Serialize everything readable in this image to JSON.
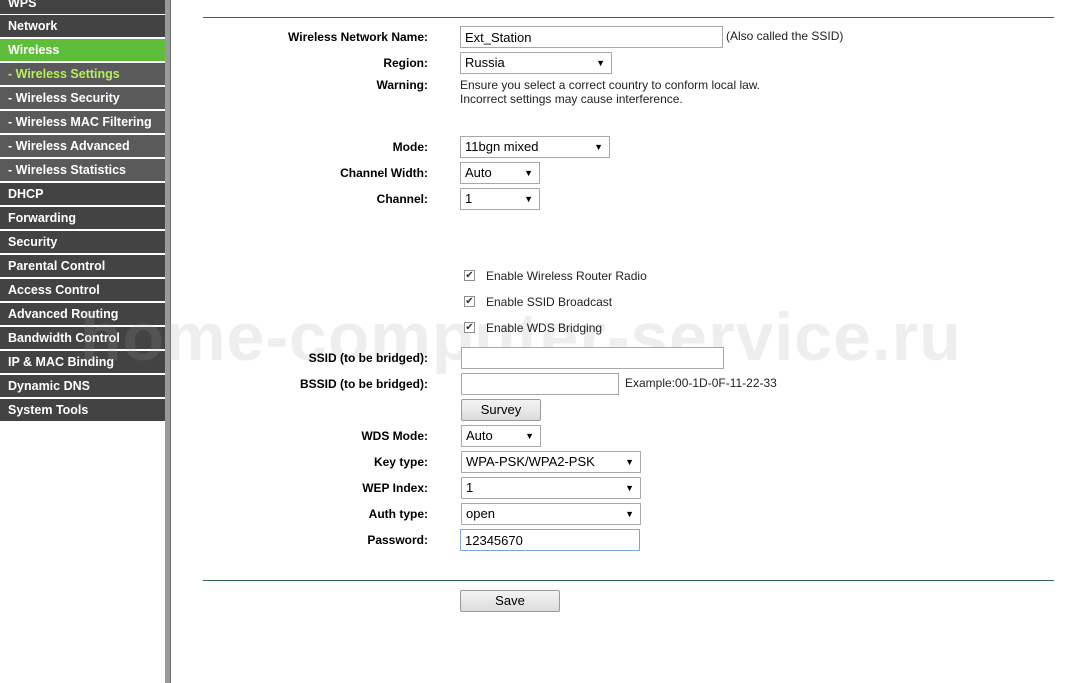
{
  "sidebar": {
    "items": [
      {
        "label": "WPS",
        "active": false,
        "sub": false
      },
      {
        "label": "Network",
        "active": false,
        "sub": false
      },
      {
        "label": "Wireless",
        "active": true,
        "sub": false
      },
      {
        "label": "- Wireless Settings",
        "active": true,
        "sub": true
      },
      {
        "label": "- Wireless Security",
        "active": false,
        "sub": true
      },
      {
        "label": "- Wireless MAC Filtering",
        "active": false,
        "sub": true
      },
      {
        "label": "- Wireless Advanced",
        "active": false,
        "sub": true
      },
      {
        "label": "- Wireless Statistics",
        "active": false,
        "sub": true
      },
      {
        "label": "DHCP",
        "active": false,
        "sub": false
      },
      {
        "label": "Forwarding",
        "active": false,
        "sub": false
      },
      {
        "label": "Security",
        "active": false,
        "sub": false
      },
      {
        "label": "Parental Control",
        "active": false,
        "sub": false
      },
      {
        "label": "Access Control",
        "active": false,
        "sub": false
      },
      {
        "label": "Advanced Routing",
        "active": false,
        "sub": false
      },
      {
        "label": "Bandwidth Control",
        "active": false,
        "sub": false
      },
      {
        "label": "IP & MAC Binding",
        "active": false,
        "sub": false
      },
      {
        "label": "Dynamic DNS",
        "active": false,
        "sub": false
      },
      {
        "label": "System Tools",
        "active": false,
        "sub": false
      }
    ]
  },
  "form": {
    "ssid_label": "Wireless Network Name:",
    "ssid_value": "Ext_Station",
    "ssid_note": "(Also called the SSID)",
    "region_label": "Region:",
    "region_value": "Russia",
    "warning_label": "Warning:",
    "warning_line1": "Ensure you select a correct country to conform local law.",
    "warning_line2": "Incorrect settings may cause interference.",
    "mode_label": "Mode:",
    "mode_value": "11bgn mixed",
    "width_label": "Channel Width:",
    "width_value": "Auto",
    "channel_label": "Channel:",
    "channel_value": "1",
    "radio_label": "Enable Wireless Router Radio",
    "broadcast_label": "Enable SSID Broadcast",
    "wds_label": "Enable WDS Bridging",
    "bridge_ssid_label": "SSID (to be bridged):",
    "bridge_ssid_value": "",
    "bridge_bssid_label": "BSSID (to be bridged):",
    "bridge_bssid_value": "",
    "bssid_example": "Example:00-1D-0F-11-22-33",
    "survey_button": "Survey",
    "wds_mode_label": "WDS Mode:",
    "wds_mode_value": "Auto",
    "key_type_label": "Key type:",
    "key_type_value": "WPA-PSK/WPA2-PSK",
    "wep_index_label": "WEP Index:",
    "wep_index_value": "1",
    "auth_type_label": "Auth type:",
    "auth_type_value": "open",
    "password_label": "Password:",
    "password_value": "12345670",
    "save_button": "Save",
    "dropdown_arrow": "▼",
    "checkmark": "✔"
  },
  "watermark": "home-computer-service.ru"
}
